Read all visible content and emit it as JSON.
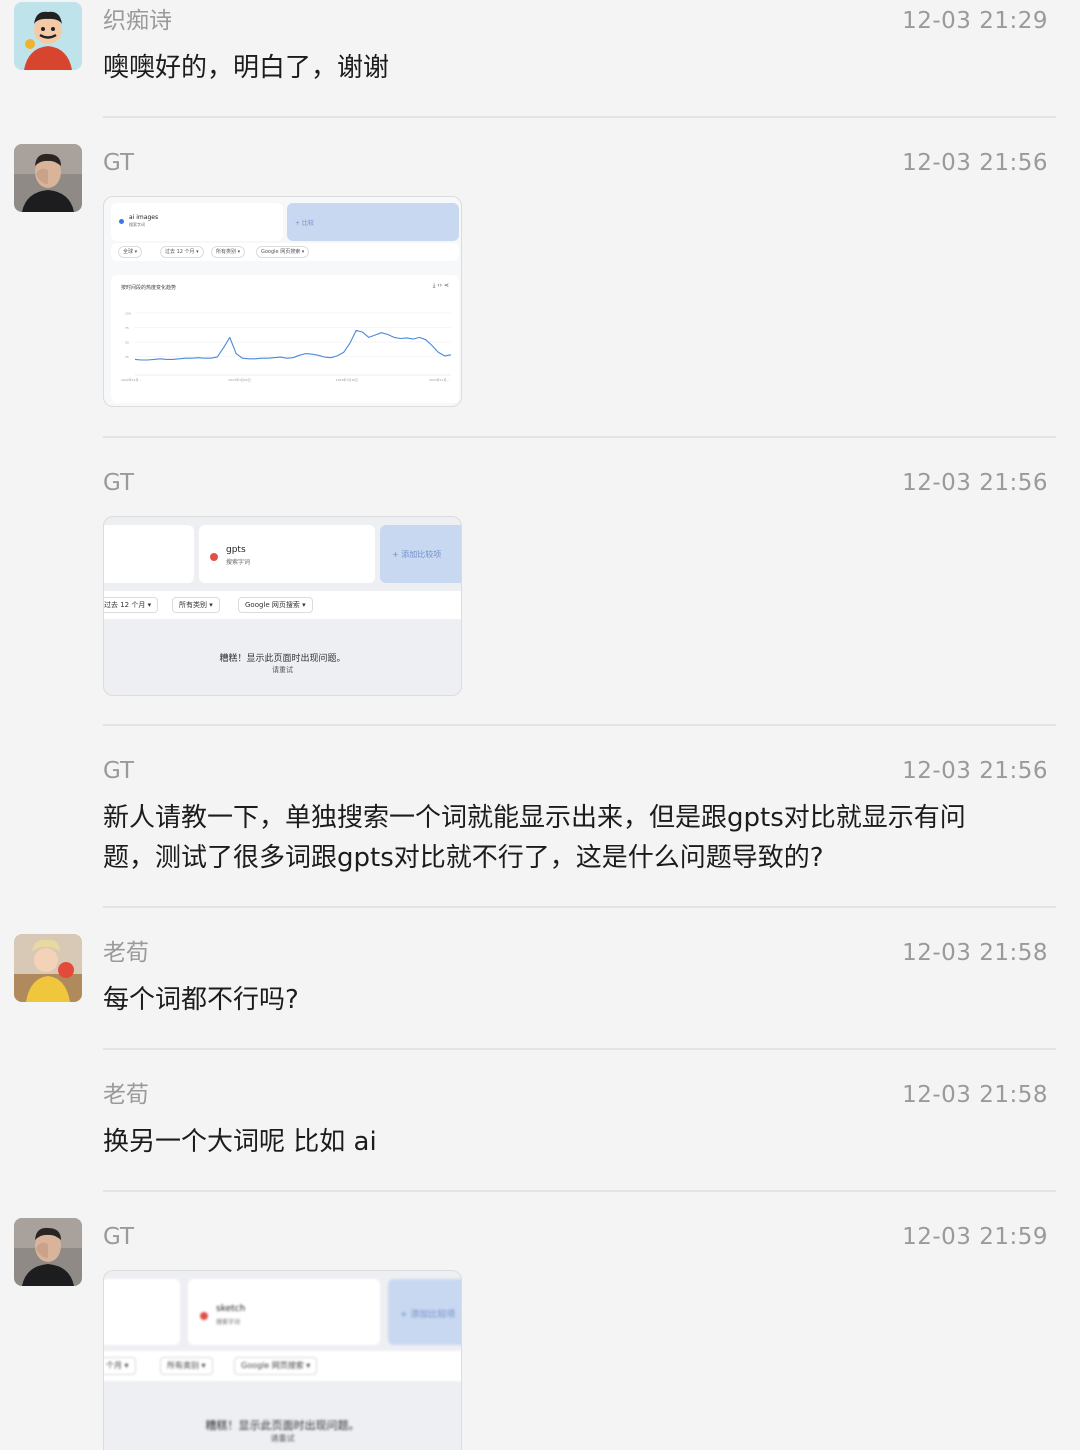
{
  "messages": [
    {
      "sender": "织痴诗",
      "time": "12-03 21:29",
      "text": "噢噢好的，明白了，谢谢"
    },
    {
      "sender": "GT",
      "time": "12-03 21:56"
    },
    {
      "sender": "GT",
      "time": "12-03 21:56"
    },
    {
      "sender": "GT",
      "time": "12-03 21:56",
      "text_line1": "新人请教一下，单独搜索一个词就能显示出来，但是跟gpts对比就显示有问",
      "text_line2": "题，测试了很多词跟gpts对比就不行了，这是什么问题导致的?"
    },
    {
      "sender": "老荀",
      "time": "12-03 21:58",
      "text": "每个词都不行吗?"
    },
    {
      "sender": "老荀",
      "time": "12-03 21:58",
      "text": "换另一个大词呢 比如 ai"
    },
    {
      "sender": "GT",
      "time": "12-03 21:59"
    }
  ],
  "shot1": {
    "term": "ai images",
    "term_sub": "搜索字词",
    "compare": "+ 比较",
    "filters": [
      "全球 ▾",
      "过去 12 个月 ▾",
      "所有类别 ▾",
      "Google 网页搜索 ▾"
    ],
    "chart_title": "按时间段的热度变化趋势",
    "chart_icons": "⤓ ‹› ⋖",
    "y_ticks": [
      "100",
      "75",
      "50",
      "25"
    ],
    "x_ticks": [
      "2022年12月…",
      "2023年3月26日",
      "2023年7月16日",
      "2023年11月…"
    ],
    "line_color": "#4a89dc",
    "chart_data": {
      "type": "line",
      "values": [
        20,
        19,
        19,
        20,
        21,
        20,
        20,
        21,
        22,
        22,
        23,
        22,
        22,
        24,
        40,
        58,
        30,
        22,
        21,
        21,
        22,
        22,
        23,
        24,
        22,
        23,
        27,
        30,
        29,
        27,
        24,
        23,
        26,
        32,
        48,
        70,
        67,
        58,
        62,
        66,
        63,
        58,
        56,
        57,
        55,
        58,
        54,
        44,
        32,
        26,
        28
      ],
      "ylim": [
        0,
        100
      ]
    }
  },
  "shot2": {
    "term": "gpts",
    "term_sub": "搜索字词",
    "compare": "+ 添加比较项",
    "filters": [
      "过去 12 个月 ▾",
      "所有类别 ▾",
      "Google 网页搜索 ▾"
    ],
    "error": "糟糕！显示此页面时出现问题。",
    "retry": "请重试",
    "dot_color": "#e0504a"
  },
  "shot3": {
    "term": "sketch",
    "term_sub": "搜索字词",
    "compare": "+ 添加比较项",
    "filters": [
      "个月 ▾",
      "所有类别 ▾",
      "Google 网页搜索 ▾"
    ],
    "error": "糟糕！显示此页面时出现问题。",
    "retry": "请重试"
  }
}
